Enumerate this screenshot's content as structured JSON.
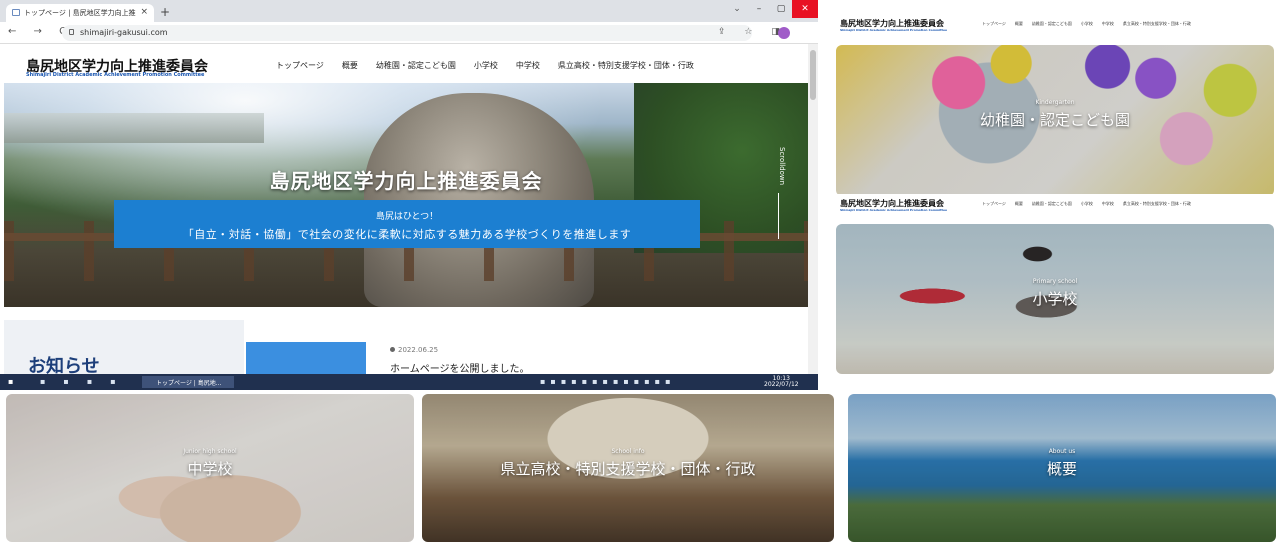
{
  "browser": {
    "tab_title": "トップページ | 島尻地区学力向上推",
    "tab_close": "×",
    "new_tab": "+",
    "window_controls": [
      "⌄",
      "–",
      "▢",
      "✕"
    ],
    "nav_buttons": "← → C",
    "url": "shimajiri-gakusui.com",
    "addr_icons": "⇪ ☆ ◨",
    "profile_color": "#a05bc8"
  },
  "site": {
    "logo": "島尻地区学力向上推進委員会",
    "logo_sub": "Shimajiri District Academic Achievement Promotion Committee",
    "nav": [
      "トップページ",
      "概要",
      "幼稚園・認定こども園",
      "小学校",
      "中学校",
      "県立高校・特別支援学校・団体・行政"
    ]
  },
  "hero": {
    "title": "島尻地区学力向上推進委員会",
    "line1": "島尻はひとつ！",
    "line2": "「自立・対話・協働」で社会の変化に柔軟に対応する魅力ある学校づくりを推進します",
    "scroll_label": "Scrolldown",
    "accent_color": "#1c7fd1"
  },
  "news": {
    "heading": "お知らせ",
    "date": "2022.06.25",
    "text": "ホームページを公開しました。"
  },
  "taskbar": {
    "app_label": "トップページ | 島尻地...",
    "time": "10:13",
    "date": "2022/07/12"
  },
  "cards": {
    "kindergarten": {
      "en": "Kindergarten",
      "jp": "幼稚園・認定こども園"
    },
    "primary": {
      "en": "Primary school",
      "jp": "小学校"
    },
    "junior": {
      "en": "Junior high school",
      "jp": "中学校"
    },
    "school_info": {
      "en": "School info",
      "jp": "県立高校・特別支援学校・団体・行政"
    },
    "about": {
      "en": "About us",
      "jp": "概要"
    }
  }
}
